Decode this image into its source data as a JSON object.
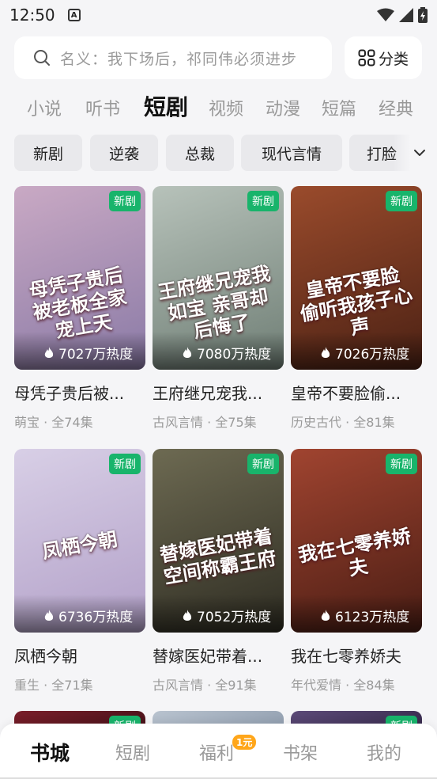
{
  "status_bar": {
    "time": "12:50",
    "notif_glyph": "A"
  },
  "search": {
    "placeholder": "名义：我下场后，祁同伟必须进步"
  },
  "category_button": {
    "label": "分类"
  },
  "tabs": [
    {
      "label": "小说"
    },
    {
      "label": "听书"
    },
    {
      "label": "短剧"
    },
    {
      "label": "视频"
    },
    {
      "label": "动漫"
    },
    {
      "label": "短篇"
    },
    {
      "label": "经典"
    }
  ],
  "active_tab": "短剧",
  "chips": [
    {
      "label": "新剧"
    },
    {
      "label": "逆袭"
    },
    {
      "label": "总裁"
    },
    {
      "label": "现代言情"
    },
    {
      "label": "打脸"
    }
  ],
  "cards": [
    {
      "title": "母凭子贵后被...",
      "tag": "萌宝",
      "episodes": "全74集",
      "heat": "7027万热度",
      "badge": "新剧",
      "cover_text": "母凭子贵后 被老板全家 宠上天",
      "colors": [
        "#c9a9c4",
        "#8a7aa6"
      ]
    },
    {
      "title": "王府继兄宠我...",
      "tag": "古风言情",
      "episodes": "全75集",
      "heat": "7080万热度",
      "badge": "新剧",
      "cover_text": "王府继兄宠我如宝 亲哥却后悔了",
      "colors": [
        "#b7c2ba",
        "#6f7e75"
      ]
    },
    {
      "title": "皇帝不要脸偷...",
      "tag": "历史古代",
      "episodes": "全81集",
      "heat": "7026万热度",
      "badge": "新剧",
      "cover_text": "皇帝不要脸 偷听我孩子心声",
      "colors": [
        "#9a4b2c",
        "#4b2114"
      ]
    },
    {
      "title": "凤栖今朝",
      "tag": "重生",
      "episodes": "全71集",
      "heat": "6736万热度",
      "badge": "新剧",
      "cover_text": "凤栖今朝",
      "colors": [
        "#d8cfe6",
        "#b2a0c8"
      ]
    },
    {
      "title": "替嫁医妃带着...",
      "tag": "古风言情",
      "episodes": "全91集",
      "heat": "7052万热度",
      "badge": "新剧",
      "cover_text": "替嫁医妃带着 空间称霸王府",
      "colors": [
        "#6d6a52",
        "#2e2c22"
      ]
    },
    {
      "title": "我在七零养娇夫",
      "tag": "年代爱情",
      "episodes": "全84集",
      "heat": "6123万热度",
      "badge": "新剧",
      "cover_text": "我在七零养娇夫",
      "colors": [
        "#a04430",
        "#4a1d14"
      ]
    }
  ],
  "peek_cards": [
    {
      "badge": "新剧",
      "colors": [
        "#7a1e2a",
        "#3a0e14"
      ]
    },
    {
      "badge": "",
      "colors": [
        "#b9c3cf",
        "#8694a6"
      ]
    },
    {
      "badge": "新剧",
      "colors": [
        "#5c4a78",
        "#2d2240"
      ]
    }
  ],
  "bottom_nav": [
    {
      "label": "书城"
    },
    {
      "label": "短剧"
    },
    {
      "label": "福利"
    },
    {
      "label": "书架"
    },
    {
      "label": "我的"
    }
  ],
  "active_nav": "书城",
  "nav_badge": "1元",
  "icons": {
    "search": "search-icon",
    "grid": "grid-icon",
    "chevron": "chevron-down-icon",
    "flame": "flame-icon"
  }
}
